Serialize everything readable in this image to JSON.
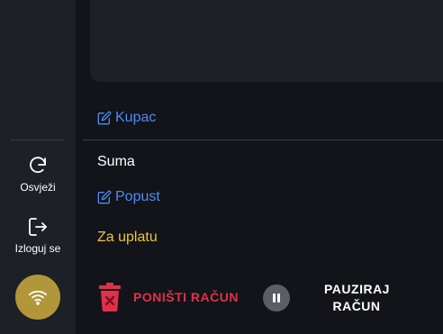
{
  "sidebar": {
    "refresh_label": "Osvježi",
    "logout_label": "Izloguj se",
    "wifi_icon": "wifi-icon",
    "accent": "#b1963a"
  },
  "receipt": {
    "customer_label": "Kupac",
    "sum_label": "Suma",
    "discount_label": "Popust",
    "to_pay_label": "Za uplatu"
  },
  "actions": {
    "cancel_label": "PONIŠTI RAČUN",
    "pause_line1": "PAUZIRAJ",
    "pause_line2": "RAČUN"
  },
  "colors": {
    "link": "#4c8df5",
    "to_pay": "#f0c33c",
    "danger": "#e0314c"
  }
}
